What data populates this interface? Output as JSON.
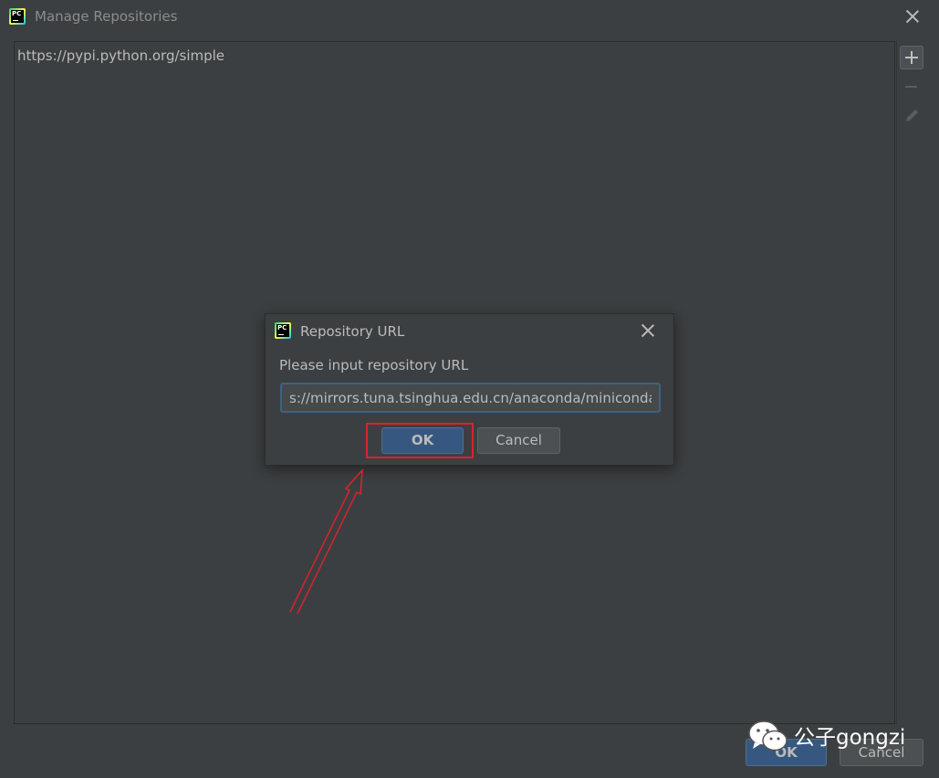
{
  "window": {
    "title": "Manage Repositories",
    "app_icon_text": "PC"
  },
  "repositories": {
    "items": [
      {
        "url": "https://pypi.python.org/simple"
      }
    ]
  },
  "toolbar": {
    "add_icon": "plus-icon",
    "remove_icon": "minus-icon",
    "edit_icon": "pencil-icon"
  },
  "footer": {
    "ok_label": "OK",
    "cancel_label": "Cancel"
  },
  "watermark": {
    "text": "公子gongzi",
    "icon": "wechat-icon"
  },
  "dialog": {
    "title": "Repository URL",
    "app_icon_text": "PC",
    "prompt": "Please input repository URL",
    "input_value": "s://mirrors.tuna.tsinghua.edu.cn/anaconda/miniconda/",
    "ok_label": "OK",
    "cancel_label": "Cancel"
  },
  "colors": {
    "background": "#3c3f41",
    "primary_button": "#365880",
    "highlight": "#d9232d",
    "text": "#bbbbbb"
  }
}
